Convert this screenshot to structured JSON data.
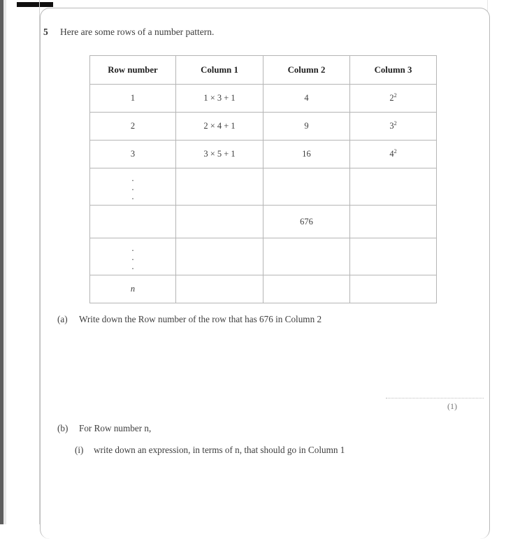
{
  "page": {
    "question_number": "5",
    "stem": "Here are some rows of a number pattern."
  },
  "table": {
    "headers": [
      "Row number",
      "Column 1",
      "Column 2",
      "Column 3"
    ],
    "rows": [
      {
        "type": "data",
        "row_number": "1",
        "column1": "1 × 3 + 1",
        "column2": "4",
        "column3_base": "2",
        "column3_exp": "2"
      },
      {
        "type": "data",
        "row_number": "2",
        "column1": "2 × 4 + 1",
        "column2": "9",
        "column3_base": "3",
        "column3_exp": "2"
      },
      {
        "type": "data",
        "row_number": "3",
        "column1": "3 × 5 + 1",
        "column2": "16",
        "column3_base": "4",
        "column3_exp": "2"
      },
      {
        "type": "dots",
        "row_number": "⋮",
        "column1": "",
        "column2": "",
        "column3_base": "",
        "column3_exp": ""
      },
      {
        "type": "value",
        "row_number": "",
        "column1": "",
        "column2": "676",
        "column3_base": "",
        "column3_exp": ""
      },
      {
        "type": "dots",
        "row_number": "⋮",
        "column1": "",
        "column2": "",
        "column3_base": "",
        "column3_exp": ""
      },
      {
        "type": "nrow",
        "row_number": "n",
        "column1": "",
        "column2": "",
        "column3_base": "",
        "column3_exp": ""
      }
    ],
    "dot_glyph": "."
  },
  "parts": {
    "a": {
      "label": "(a)",
      "text": "Write down the Row number of the row that has 676 in Column 2",
      "marks": "(1)"
    },
    "b": {
      "label": "(b)",
      "text": "For Row number n,"
    },
    "bi": {
      "label": "(i)",
      "text": "write down an expression, in terms of n, that should go in Column 1"
    }
  },
  "colors": {
    "text": "#3d3d3d",
    "table_border": "#b5b5b5",
    "page_border": "#b9b9b9",
    "registration_mark": "#100f0f"
  }
}
